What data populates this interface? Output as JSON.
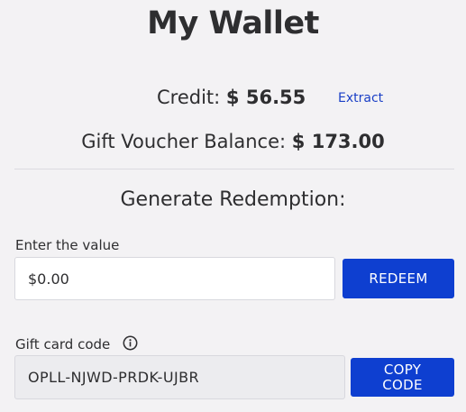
{
  "page": {
    "title": "My Wallet"
  },
  "credit": {
    "label": "Credit:",
    "amount": "$ 56.55",
    "extract_label": "Extract"
  },
  "voucher": {
    "label": "Gift Voucher Balance:",
    "amount": "$ 173.00"
  },
  "redemption": {
    "title": "Generate Redemption:",
    "value_label": "Enter the value",
    "value_input": "$0.00",
    "redeem_label": "REDEEM"
  },
  "gift_card": {
    "label": "Gift card code",
    "info_icon": "info-icon",
    "code": "OPLL-NJWD-PRDK-UJBR",
    "copy_label": "COPY\nCODE"
  },
  "colors": {
    "accent": "#0e3fd0",
    "link": "#1a3fc6",
    "background": "#f3f2f4"
  }
}
